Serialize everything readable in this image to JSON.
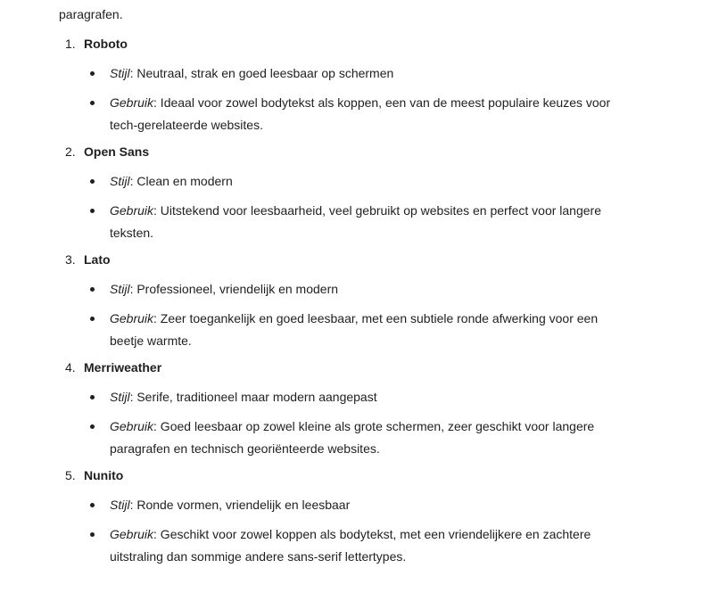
{
  "intro": "paragrafen.",
  "fonts": [
    {
      "number": "1.",
      "name": "Roboto",
      "style_label": "Stijl",
      "style_text": ": Neutraal, strak en goed leesbaar op schermen",
      "usage_label": "Gebruik",
      "usage_line1": ": Ideaal voor zowel bodytekst als koppen, een van de meest populaire keuzes voor",
      "usage_line2": "tech-gerelateerde websites."
    },
    {
      "number": "2.",
      "name": "Open Sans",
      "style_label": "Stijl",
      "style_text": ": Clean en modern",
      "usage_label": "Gebruik",
      "usage_line1": ": Uitstekend voor leesbaarheid, veel gebruikt op websites en perfect voor langere",
      "usage_line2": "teksten."
    },
    {
      "number": "3.",
      "name": "Lato",
      "style_label": "Stijl",
      "style_text": ": Professioneel, vriendelijk en modern",
      "usage_label": "Gebruik",
      "usage_line1": ": Zeer toegankelijk en goed leesbaar, met een subtiele ronde afwerking voor een",
      "usage_line2": "beetje warmte."
    },
    {
      "number": "4.",
      "name": "Merriweather",
      "style_label": "Stijl",
      "style_text": ": Serife, traditioneel maar modern aangepast",
      "usage_label": "Gebruik",
      "usage_line1": ": Goed leesbaar op zowel kleine als grote schermen, zeer geschikt voor langere",
      "usage_line2": "paragrafen en technisch georiënteerde websites."
    },
    {
      "number": "5.",
      "name": "Nunito",
      "style_label": "Stijl",
      "style_text": ": Ronde vormen, vriendelijk en leesbaar",
      "usage_label": "Gebruik",
      "usage_line1": ": Geschikt voor zowel koppen als bodytekst, met een vriendelijkere en zachtere",
      "usage_line2": "uitstraling dan sommige andere sans-serif lettertypes."
    }
  ]
}
